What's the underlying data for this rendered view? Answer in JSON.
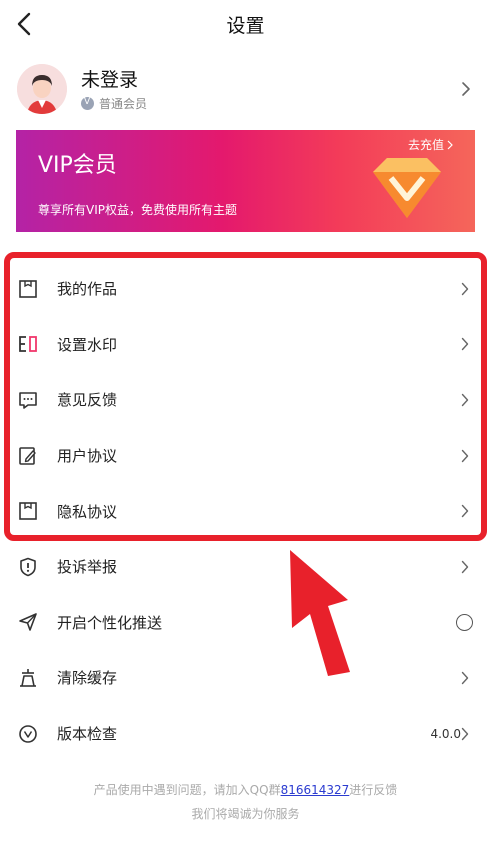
{
  "header": {
    "title": "设置"
  },
  "profile": {
    "username": "未登录",
    "member_level": "普通会员"
  },
  "vip": {
    "title": "VIP会员",
    "subtitle": "尊享所有VIP权益，免费使用所有主题",
    "recharge": "去充值"
  },
  "menu": {
    "items": [
      {
        "label": "我的作品",
        "icon": "works-icon"
      },
      {
        "label": "设置水印",
        "icon": "watermark-icon"
      },
      {
        "label": "意见反馈",
        "icon": "feedback-icon"
      },
      {
        "label": "用户协议",
        "icon": "agreement-icon"
      },
      {
        "label": "隐私协议",
        "icon": "privacy-icon"
      },
      {
        "label": "投诉举报",
        "icon": "report-icon"
      },
      {
        "label": "开启个性化推送",
        "icon": "send-icon"
      },
      {
        "label": "清除缓存",
        "icon": "clear-cache-icon"
      },
      {
        "label": "版本检查",
        "icon": "version-icon",
        "value": "4.0.0"
      }
    ]
  },
  "footer": {
    "line1_prefix": "产品使用中遇到问题，请加入QQ群",
    "qq_group": "816614327",
    "line1_suffix": "进行反馈",
    "line2": "我们将竭诚为你服务"
  },
  "colors": {
    "highlight": "#e8212b",
    "vip_start": "#b423a6",
    "vip_end": "#f5665a",
    "link": "#2b3bd0"
  }
}
